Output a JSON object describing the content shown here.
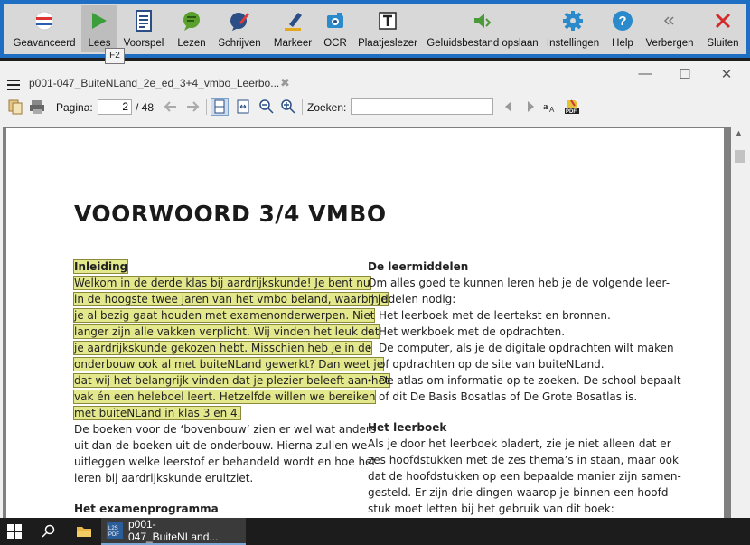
{
  "ribbon": {
    "items": [
      {
        "label": "Geavanceerd",
        "icon": "flag-icon"
      },
      {
        "label": "Lees",
        "icon": "play-icon"
      },
      {
        "label": "Voorspel",
        "icon": "document-lines-icon"
      },
      {
        "label": "Lezen",
        "icon": "speech-bubble-icon"
      },
      {
        "label": "Schrijven",
        "icon": "pen-bubble-icon"
      },
      {
        "label": "Markeer",
        "icon": "highlighter-icon"
      },
      {
        "label": "OCR",
        "icon": "camera-icon"
      },
      {
        "label": "Plaatjeslezer",
        "icon": "text-frame-icon"
      },
      {
        "label": "Geluidsbestand opslaan",
        "icon": "save-audio-icon"
      },
      {
        "label": "Instellingen",
        "icon": "gear-icon"
      },
      {
        "label": "Help",
        "icon": "help-icon"
      },
      {
        "label": "Verbergen",
        "icon": "double-chevron-left-icon"
      },
      {
        "label": "Sluiten",
        "icon": "close-icon"
      }
    ],
    "tooltip": "F2",
    "accent": "#1e6fc4"
  },
  "document": {
    "tab_title": "p001-047_BuiteNLand_2e_ed_3+4_vmbo_Leerbo...",
    "tab_close": "✖",
    "window_controls": {
      "minimize": "—",
      "maximize": "☐",
      "close": "✕"
    }
  },
  "toolbar": {
    "page_label": "Pagina:",
    "page_current": "2",
    "page_total": "/ 48",
    "search_label": "Zoeken:",
    "search_value": ""
  },
  "page": {
    "title": "VOORWOORD 3/4 VMBO",
    "left": {
      "heading_intro": "Inleiding",
      "intro_lines": [
        "Welkom in de derde klas bij aardrijkskunde! Je bent nu",
        "in de hoogste twee jaren van het vmbo beland, waarbij je",
        "je al bezig gaat houden met examenonderwerpen. Niet",
        "langer zijn alle vakken verplicht. Wij vinden het leuk dat",
        "je aardrijkskunde gekozen hebt. Misschien heb je in de",
        "onderbouw ook al met buiteNLand gewerkt? Dan weet je",
        "dat wij het belangrijk vinden dat je plezier beleeft aan het",
        "vak én een heleboel leert. Hetzelfde willen we bereiken",
        "met buiteNLand in klas 3 en 4."
      ],
      "body_lines": [
        "De boeken voor de ‘bovenbouw’ zien er wel wat anders",
        "uit dan de boeken uit de onderbouw. Hierna zullen we",
        "uitleggen welke leerstof er behandeld wordt en hoe het",
        "leren bij aardrijkskunde eruitziet."
      ],
      "heading_exam": "Het examenprogramma"
    },
    "right": {
      "heading_means": "De leermiddelen",
      "means_lines": [
        "Om alles goed te kunnen leren heb je de volgende leer-",
        "middelen nodig:"
      ],
      "bullets": [
        "Het leerboek met de leertekst en bronnen.",
        "Het werkboek met de opdrachten.",
        "De computer, als je de digitale opdrachten wilt maken",
        "of opdrachten op de site van buiteNLand.",
        "De atlas om informatie op te zoeken. De school bepaalt",
        "of dit De Basis Bosatlas of De Grote Bosatlas is."
      ],
      "heading_book": "Het leerboek",
      "book_lines": [
        "Als je door het leerboek bladert, zie je niet alleen dat er",
        "zes hoofdstukken met de zes thema’s in staan, maar ook",
        "dat de hoofdstukken op een bepaalde manier zijn samen-",
        "gesteld. Er zijn drie dingen waarop je binnen een hoofd-",
        "stuk moet letten bij het gebruik van dit boek:"
      ]
    }
  },
  "taskbar": {
    "app_label": "p001-047_BuiteNLand..."
  }
}
